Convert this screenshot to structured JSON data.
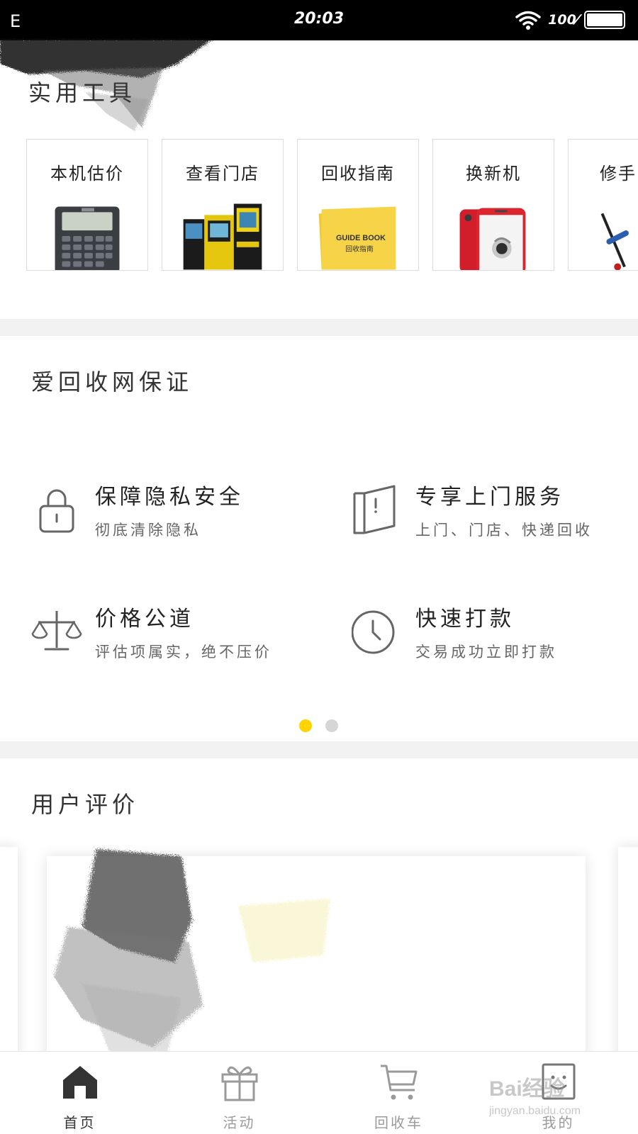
{
  "status_bar": {
    "left_glyph": "E",
    "time": "20:03",
    "battery": "100"
  },
  "tools": {
    "title": "实用工具",
    "items": [
      {
        "label": "本机估价",
        "icon": "calculator-icon"
      },
      {
        "label": "查看门店",
        "icon": "store-kiosk-icon"
      },
      {
        "label": "回收指南",
        "icon": "guide-book-icon"
      },
      {
        "label": "换新机",
        "icon": "red-phone-icon"
      },
      {
        "label": "修手",
        "icon": "repair-tools-icon"
      }
    ],
    "guide_book_text": "GUIDE BOOK",
    "guide_book_subtext": "回收指南"
  },
  "guarantee": {
    "title": "爱回收网保证",
    "features": [
      {
        "title": "保障隐私安全",
        "subtitle": "彻底清除隐私",
        "icon": "lock-icon"
      },
      {
        "title": "专享上门服务",
        "subtitle": "上门、门店、快递回收",
        "icon": "door-icon"
      },
      {
        "title": "价格公道",
        "subtitle": "评估项属实，绝不压价",
        "icon": "scale-icon"
      },
      {
        "title": "快速打款",
        "subtitle": "交易成功立即打款",
        "icon": "clock-icon"
      }
    ],
    "active_page": 1,
    "page_count": 2
  },
  "reviews": {
    "title": "用户评价"
  },
  "tab_bar": {
    "tabs": [
      {
        "label": "首页",
        "icon": "home-icon",
        "active": true
      },
      {
        "label": "活动",
        "icon": "gift-icon",
        "active": false
      },
      {
        "label": "回收车",
        "icon": "cart-icon",
        "active": false
      },
      {
        "label": "我的",
        "icon": "profile-icon",
        "active": false
      }
    ]
  },
  "watermark": {
    "brand": "Bai经验",
    "url": "jingyan.baidu.com"
  },
  "colors": {
    "accent": "#ffd400",
    "dot_inactive": "#d6d6d6",
    "tab_active": "#333333",
    "tab_inactive": "#9a9a9a"
  }
}
